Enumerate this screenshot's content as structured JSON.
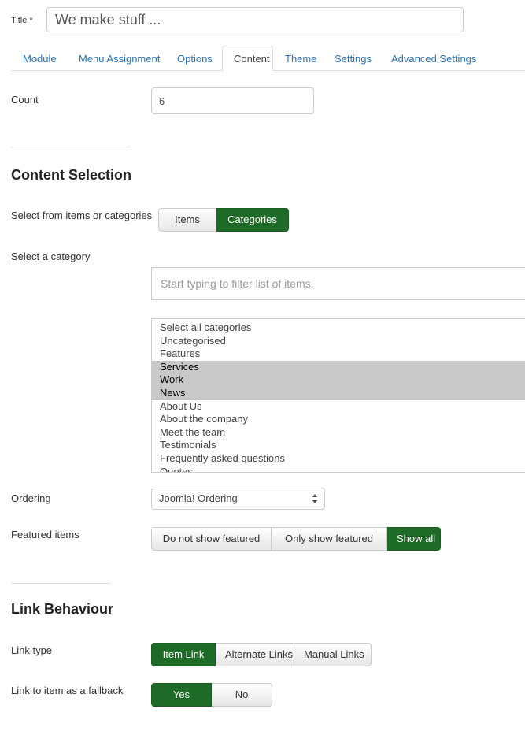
{
  "title_field": {
    "label": "Title *",
    "value": "We make stuff ..."
  },
  "tabs": [
    {
      "label": "Module",
      "active": false
    },
    {
      "label": "Menu Assignment",
      "active": false
    },
    {
      "label": "Options",
      "active": false
    },
    {
      "label": "Content",
      "active": true
    },
    {
      "label": "Theme",
      "active": false
    },
    {
      "label": "Settings",
      "active": false
    },
    {
      "label": "Advanced Settings",
      "active": false
    }
  ],
  "count_field": {
    "label": "Count",
    "value": "6"
  },
  "content_selection": {
    "heading": "Content Selection",
    "source_field": {
      "label": "Select from items or categories",
      "options": [
        {
          "label": "Items",
          "active": false
        },
        {
          "label": "Categories",
          "active": true
        }
      ]
    },
    "category_field": {
      "label": "Select a category",
      "filter_placeholder": "Start typing to filter list of items.",
      "filter_value": "",
      "options": [
        {
          "label": "Select all categories",
          "selected": false
        },
        {
          "label": "Uncategorised",
          "selected": false
        },
        {
          "label": "Features",
          "selected": false
        },
        {
          "label": "Services",
          "selected": true
        },
        {
          "label": "Work",
          "selected": true
        },
        {
          "label": "News",
          "selected": true
        },
        {
          "label": "About Us",
          "selected": false
        },
        {
          "label": "About the company",
          "selected": false
        },
        {
          "label": "Meet the team",
          "selected": false
        },
        {
          "label": "Testimonials",
          "selected": false
        },
        {
          "label": "Frequently asked questions",
          "selected": false
        },
        {
          "label": "Quotes",
          "selected": false
        }
      ]
    },
    "ordering_field": {
      "label": "Ordering",
      "value": "Joomla! Ordering"
    },
    "featured_field": {
      "label": "Featured items",
      "options": [
        {
          "label": "Do not show featured",
          "active": false
        },
        {
          "label": "Only show featured",
          "active": false
        },
        {
          "label": "Show all",
          "active": true
        }
      ]
    }
  },
  "link_behaviour": {
    "heading": "Link Behaviour",
    "link_type_field": {
      "label": "Link type",
      "options": [
        {
          "label": "Item Link",
          "active": true
        },
        {
          "label": "Alternate Links",
          "active": false
        },
        {
          "label": "Manual Links",
          "active": false
        }
      ]
    },
    "fallback_field": {
      "label": "Link to item as a fallback",
      "options": [
        {
          "label": "Yes",
          "active": true
        },
        {
          "label": "No",
          "active": false
        }
      ]
    }
  },
  "colors": {
    "accent_green": "#1e6b27",
    "link_blue": "#2a72b5",
    "selection_gray": "#c9c9c9",
    "border_gray": "#cccccc"
  }
}
